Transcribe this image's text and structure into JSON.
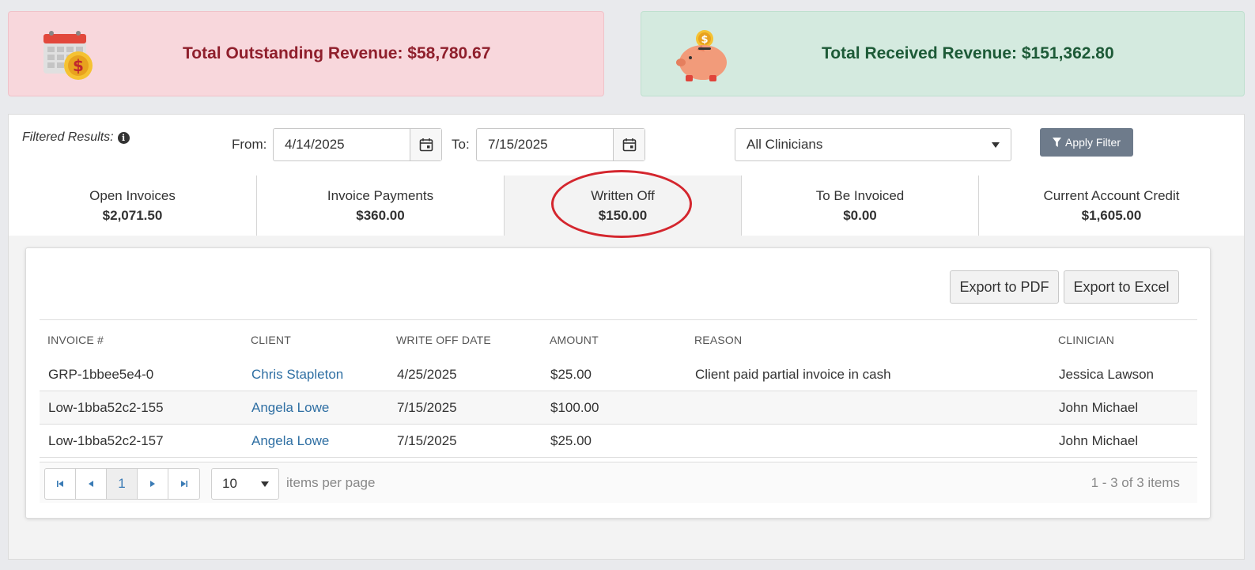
{
  "summary": {
    "outstanding": "Total Outstanding Revenue: $58,780.67",
    "received": "Total Received Revenue: $151,362.80"
  },
  "filter": {
    "label": "Filtered Results:",
    "from_label": "From:",
    "from_value": "4/14/2025",
    "to_label": "To:",
    "to_value": "7/15/2025",
    "clinician_select": "All Clinicians",
    "apply_label": "Apply Filter"
  },
  "tabs": [
    {
      "label": "Open Invoices",
      "value": "$2,071.50"
    },
    {
      "label": "Invoice Payments",
      "value": "$360.00"
    },
    {
      "label": "Written Off",
      "value": "$150.00"
    },
    {
      "label": "To Be Invoiced",
      "value": "$0.00"
    },
    {
      "label": "Current Account Credit",
      "value": "$1,605.00"
    }
  ],
  "export": {
    "pdf": "Export to PDF",
    "excel": "Export to Excel"
  },
  "table": {
    "headers": [
      "INVOICE #",
      "CLIENT",
      "WRITE OFF DATE",
      "AMOUNT",
      "REASON",
      "CLINICIAN"
    ],
    "rows": [
      [
        "GRP-1bbee5e4-0",
        "Chris Stapleton",
        "4/25/2025",
        "$25.00",
        "Client paid partial invoice in cash",
        "Jessica Lawson"
      ],
      [
        "Low-1bba52c2-155",
        "Angela Lowe",
        "7/15/2025",
        "$100.00",
        "",
        "John Michael"
      ],
      [
        "Low-1bba52c2-157",
        "Angela Lowe",
        "7/15/2025",
        "$25.00",
        "",
        "John Michael"
      ]
    ]
  },
  "pager": {
    "current_page": "1",
    "page_size": "10",
    "per_page_label": "items per page",
    "info": "1 - 3 of 3 items"
  },
  "colors": {
    "outstanding_bg": "#f8d7dc",
    "received_bg": "#d4eadf",
    "highlight_circle": "#d4262e",
    "link": "#2f6fa3"
  }
}
